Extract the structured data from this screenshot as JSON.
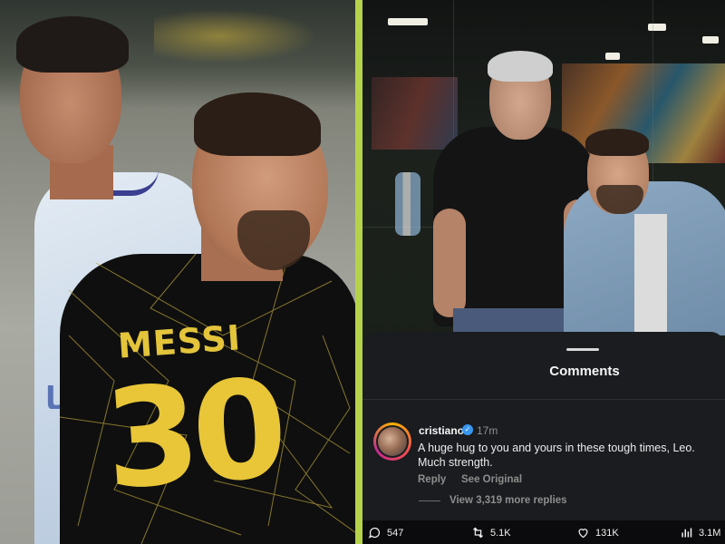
{
  "left_photo": {
    "jersey_name": "MESSI",
    "jersey_number": "30",
    "sponsor_text": "ﺭﻳﺎ"
  },
  "post": {
    "comments_sheet": {
      "title": "Comments"
    },
    "comment": {
      "username": "cristiano",
      "verified": true,
      "time": "17m",
      "text": "A huge hug to you and yours in these tough times, Leo.\nMuch strength.",
      "reply_label": "Reply",
      "see_original_label": "See Original",
      "view_replies_label": "View 3,319 more replies"
    },
    "actions": {
      "comments_count": "547",
      "reposts_count": "5.1K",
      "likes_count": "131K",
      "views_count": "3.1M"
    }
  },
  "colors": {
    "divider": "#b5d24b",
    "verified_badge": "#3897f0",
    "sheet_background": "#1a1c1f"
  },
  "icons": [
    "comment-icon",
    "repost-icon",
    "heart-icon",
    "views-icon",
    "verified-badge-icon"
  ]
}
